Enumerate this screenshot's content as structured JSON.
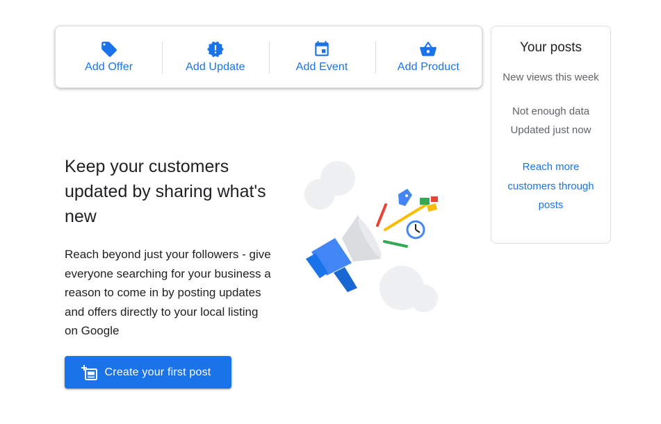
{
  "actions": [
    {
      "label": "Add Offer",
      "icon": "tag-icon"
    },
    {
      "label": "Add Update",
      "icon": "alert-badge-icon"
    },
    {
      "label": "Add Event",
      "icon": "calendar-icon"
    },
    {
      "label": "Add Product",
      "icon": "shopping-basket-icon"
    }
  ],
  "posts_panel": {
    "title": "Your posts",
    "subtitle": "New views this week",
    "status_line1": "Not enough data",
    "status_line2": "Updated just now",
    "link": "Reach more customers through posts"
  },
  "hero": {
    "headline": "Keep your customers updated by sharing what's new",
    "body": "Reach beyond just your followers - give everyone searching for your business a reason to come in by posting updates and offers directly to your local listing on Google",
    "illustration": "megaphone-illustration"
  },
  "cta": {
    "label": "Create your first post",
    "icon": "add-post-icon"
  },
  "colors": {
    "accent": "#1a73e8",
    "text": "#202124",
    "muted": "#5f6368",
    "border": "#dadce0"
  }
}
